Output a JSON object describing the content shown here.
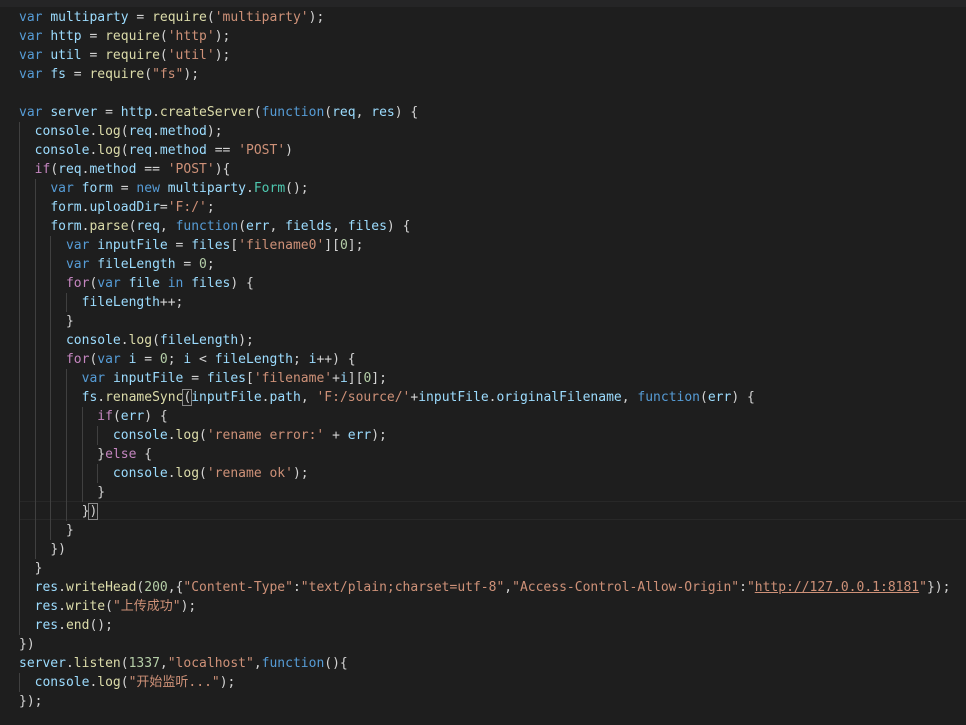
{
  "theme": {
    "background": "#1e1e1e",
    "keyword": "#569cd6",
    "control": "#c586c0",
    "variable": "#9cdcfe",
    "function": "#dcdcaa",
    "class": "#4ec9b0",
    "string": "#ce9178",
    "number": "#b5cea8",
    "plain": "#d4d4d4"
  },
  "editor": {
    "language": "javascript",
    "current_line": 27,
    "lines": [
      {
        "indent": 0,
        "tokens": [
          [
            "kw",
            "var"
          ],
          [
            "t",
            " "
          ],
          [
            "v",
            "multiparty"
          ],
          [
            "t",
            " = "
          ],
          [
            "f",
            "require"
          ],
          [
            "t",
            "("
          ],
          [
            "s",
            "'multiparty'"
          ],
          [
            "t",
            ");"
          ]
        ]
      },
      {
        "indent": 0,
        "tokens": [
          [
            "kw",
            "var"
          ],
          [
            "t",
            " "
          ],
          [
            "v",
            "http"
          ],
          [
            "t",
            " = "
          ],
          [
            "f",
            "require"
          ],
          [
            "t",
            "("
          ],
          [
            "s",
            "'http'"
          ],
          [
            "t",
            ");"
          ]
        ]
      },
      {
        "indent": 0,
        "tokens": [
          [
            "kw",
            "var"
          ],
          [
            "t",
            " "
          ],
          [
            "v",
            "util"
          ],
          [
            "t",
            " = "
          ],
          [
            "f",
            "require"
          ],
          [
            "t",
            "("
          ],
          [
            "s",
            "'util'"
          ],
          [
            "t",
            ");"
          ]
        ]
      },
      {
        "indent": 0,
        "tokens": [
          [
            "kw",
            "var"
          ],
          [
            "t",
            " "
          ],
          [
            "v",
            "fs"
          ],
          [
            "t",
            " = "
          ],
          [
            "f",
            "require"
          ],
          [
            "t",
            "("
          ],
          [
            "s",
            "\"fs\""
          ],
          [
            "t",
            ");"
          ]
        ]
      },
      {
        "indent": 0,
        "tokens": []
      },
      {
        "indent": 0,
        "tokens": [
          [
            "kw",
            "var"
          ],
          [
            "t",
            " "
          ],
          [
            "v",
            "server"
          ],
          [
            "t",
            " = "
          ],
          [
            "v",
            "http"
          ],
          [
            "t",
            "."
          ],
          [
            "f",
            "createServer"
          ],
          [
            "t",
            "("
          ],
          [
            "kw",
            "function"
          ],
          [
            "t",
            "("
          ],
          [
            "v",
            "req"
          ],
          [
            "t",
            ", "
          ],
          [
            "v",
            "res"
          ],
          [
            "t",
            ") {"
          ]
        ]
      },
      {
        "indent": 1,
        "tokens": [
          [
            "v",
            "console"
          ],
          [
            "t",
            "."
          ],
          [
            "f",
            "log"
          ],
          [
            "t",
            "("
          ],
          [
            "v",
            "req"
          ],
          [
            "t",
            "."
          ],
          [
            "v",
            "method"
          ],
          [
            "t",
            ");"
          ]
        ]
      },
      {
        "indent": 1,
        "tokens": [
          [
            "v",
            "console"
          ],
          [
            "t",
            "."
          ],
          [
            "f",
            "log"
          ],
          [
            "t",
            "("
          ],
          [
            "v",
            "req"
          ],
          [
            "t",
            "."
          ],
          [
            "v",
            "method"
          ],
          [
            "t",
            " == "
          ],
          [
            "s",
            "'POST'"
          ],
          [
            "t",
            ")"
          ]
        ]
      },
      {
        "indent": 1,
        "tokens": [
          [
            "c",
            "if"
          ],
          [
            "t",
            "("
          ],
          [
            "v",
            "req"
          ],
          [
            "t",
            "."
          ],
          [
            "v",
            "method"
          ],
          [
            "t",
            " == "
          ],
          [
            "s",
            "'POST'"
          ],
          [
            "t",
            "){"
          ]
        ]
      },
      {
        "indent": 2,
        "tokens": [
          [
            "kw",
            "var"
          ],
          [
            "t",
            " "
          ],
          [
            "v",
            "form"
          ],
          [
            "t",
            " = "
          ],
          [
            "kw",
            "new"
          ],
          [
            "t",
            " "
          ],
          [
            "v",
            "multiparty"
          ],
          [
            "t",
            "."
          ],
          [
            "cl",
            "Form"
          ],
          [
            "t",
            "();"
          ]
        ]
      },
      {
        "indent": 2,
        "tokens": [
          [
            "v",
            "form"
          ],
          [
            "t",
            "."
          ],
          [
            "v",
            "uploadDir"
          ],
          [
            "t",
            "="
          ],
          [
            "s",
            "'F:/'"
          ],
          [
            "t",
            ";"
          ]
        ]
      },
      {
        "indent": 2,
        "tokens": [
          [
            "v",
            "form"
          ],
          [
            "t",
            "."
          ],
          [
            "f",
            "parse"
          ],
          [
            "t",
            "("
          ],
          [
            "v",
            "req"
          ],
          [
            "t",
            ", "
          ],
          [
            "kw",
            "function"
          ],
          [
            "t",
            "("
          ],
          [
            "v",
            "err"
          ],
          [
            "t",
            ", "
          ],
          [
            "v",
            "fields"
          ],
          [
            "t",
            ", "
          ],
          [
            "v",
            "files"
          ],
          [
            "t",
            ") {"
          ]
        ]
      },
      {
        "indent": 3,
        "tokens": [
          [
            "kw",
            "var"
          ],
          [
            "t",
            " "
          ],
          [
            "v",
            "inputFile"
          ],
          [
            "t",
            " = "
          ],
          [
            "v",
            "files"
          ],
          [
            "t",
            "["
          ],
          [
            "s",
            "'filename0'"
          ],
          [
            "t",
            "]["
          ],
          [
            "n",
            "0"
          ],
          [
            "t",
            "];"
          ]
        ]
      },
      {
        "indent": 3,
        "tokens": [
          [
            "kw",
            "var"
          ],
          [
            "t",
            " "
          ],
          [
            "v",
            "fileLength"
          ],
          [
            "t",
            " = "
          ],
          [
            "n",
            "0"
          ],
          [
            "t",
            ";"
          ]
        ]
      },
      {
        "indent": 3,
        "tokens": [
          [
            "c",
            "for"
          ],
          [
            "t",
            "("
          ],
          [
            "kw",
            "var"
          ],
          [
            "t",
            " "
          ],
          [
            "v",
            "file"
          ],
          [
            "t",
            " "
          ],
          [
            "kw",
            "in"
          ],
          [
            "t",
            " "
          ],
          [
            "v",
            "files"
          ],
          [
            "t",
            ") {"
          ]
        ]
      },
      {
        "indent": 4,
        "tokens": [
          [
            "v",
            "fileLength"
          ],
          [
            "t",
            "++;"
          ]
        ]
      },
      {
        "indent": 3,
        "tokens": [
          [
            "t",
            "}"
          ]
        ]
      },
      {
        "indent": 3,
        "tokens": [
          [
            "v",
            "console"
          ],
          [
            "t",
            "."
          ],
          [
            "f",
            "log"
          ],
          [
            "t",
            "("
          ],
          [
            "v",
            "fileLength"
          ],
          [
            "t",
            ");"
          ]
        ]
      },
      {
        "indent": 3,
        "tokens": [
          [
            "c",
            "for"
          ],
          [
            "t",
            "("
          ],
          [
            "kw",
            "var"
          ],
          [
            "t",
            " "
          ],
          [
            "v",
            "i"
          ],
          [
            "t",
            " = "
          ],
          [
            "n",
            "0"
          ],
          [
            "t",
            "; "
          ],
          [
            "v",
            "i"
          ],
          [
            "t",
            " < "
          ],
          [
            "v",
            "fileLength"
          ],
          [
            "t",
            "; "
          ],
          [
            "v",
            "i"
          ],
          [
            "t",
            "++) {"
          ]
        ]
      },
      {
        "indent": 4,
        "tokens": [
          [
            "kw",
            "var"
          ],
          [
            "t",
            " "
          ],
          [
            "v",
            "inputFile"
          ],
          [
            "t",
            " = "
          ],
          [
            "v",
            "files"
          ],
          [
            "t",
            "["
          ],
          [
            "s",
            "'filename'"
          ],
          [
            "t",
            "+"
          ],
          [
            "v",
            "i"
          ],
          [
            "t",
            "]["
          ],
          [
            "n",
            "0"
          ],
          [
            "t",
            "];"
          ]
        ]
      },
      {
        "indent": 4,
        "tokens": [
          [
            "v",
            "fs"
          ],
          [
            "t",
            "."
          ],
          [
            "f",
            "renameSync"
          ],
          [
            "bm",
            "("
          ],
          [
            "v",
            "inputFile"
          ],
          [
            "t",
            "."
          ],
          [
            "v",
            "path"
          ],
          [
            "t",
            ", "
          ],
          [
            "s",
            "'F:/source/'"
          ],
          [
            "t",
            "+"
          ],
          [
            "v",
            "inputFile"
          ],
          [
            "t",
            "."
          ],
          [
            "v",
            "originalFilename"
          ],
          [
            "t",
            ", "
          ],
          [
            "kw",
            "function"
          ],
          [
            "t",
            "("
          ],
          [
            "v",
            "err"
          ],
          [
            "t",
            ") {"
          ]
        ]
      },
      {
        "indent": 5,
        "tokens": [
          [
            "c",
            "if"
          ],
          [
            "t",
            "("
          ],
          [
            "v",
            "err"
          ],
          [
            "t",
            ") {"
          ]
        ]
      },
      {
        "indent": 6,
        "tokens": [
          [
            "v",
            "console"
          ],
          [
            "t",
            "."
          ],
          [
            "f",
            "log"
          ],
          [
            "t",
            "("
          ],
          [
            "s",
            "'rename error:'"
          ],
          [
            "t",
            " + "
          ],
          [
            "v",
            "err"
          ],
          [
            "t",
            ");"
          ]
        ]
      },
      {
        "indent": 5,
        "tokens": [
          [
            "t",
            "}"
          ],
          [
            "c",
            "else"
          ],
          [
            "t",
            " {"
          ]
        ]
      },
      {
        "indent": 6,
        "tokens": [
          [
            "v",
            "console"
          ],
          [
            "t",
            "."
          ],
          [
            "f",
            "log"
          ],
          [
            "t",
            "("
          ],
          [
            "s",
            "'rename ok'"
          ],
          [
            "t",
            ");"
          ]
        ]
      },
      {
        "indent": 5,
        "tokens": [
          [
            "t",
            "}"
          ]
        ]
      },
      {
        "indent": 4,
        "tokens": [
          [
            "t",
            "}"
          ],
          [
            "bm",
            ")"
          ]
        ]
      },
      {
        "indent": 3,
        "tokens": [
          [
            "t",
            "}"
          ]
        ]
      },
      {
        "indent": 2,
        "tokens": [
          [
            "t",
            "})"
          ]
        ]
      },
      {
        "indent": 1,
        "tokens": [
          [
            "t",
            "}"
          ]
        ]
      },
      {
        "indent": 1,
        "tokens": [
          [
            "v",
            "res"
          ],
          [
            "t",
            "."
          ],
          [
            "f",
            "writeHead"
          ],
          [
            "t",
            "("
          ],
          [
            "n",
            "200"
          ],
          [
            "t",
            ",{"
          ],
          [
            "s",
            "\"Content-Type\""
          ],
          [
            "t",
            ":"
          ],
          [
            "s",
            "\"text/plain;charset=utf-8\""
          ],
          [
            "t",
            ","
          ],
          [
            "s",
            "\"Access-Control-Allow-Origin\""
          ],
          [
            "t",
            ":"
          ],
          [
            "s",
            "\""
          ],
          [
            "u",
            "http://127.0.0.1:8181"
          ],
          [
            "s",
            "\""
          ],
          [
            "t",
            "});"
          ]
        ]
      },
      {
        "indent": 1,
        "tokens": [
          [
            "v",
            "res"
          ],
          [
            "t",
            "."
          ],
          [
            "f",
            "write"
          ],
          [
            "t",
            "("
          ],
          [
            "s",
            "\"上传成功\""
          ],
          [
            "t",
            ");"
          ]
        ]
      },
      {
        "indent": 1,
        "tokens": [
          [
            "v",
            "res"
          ],
          [
            "t",
            "."
          ],
          [
            "f",
            "end"
          ],
          [
            "t",
            "();"
          ]
        ]
      },
      {
        "indent": 0,
        "tokens": [
          [
            "t",
            "})"
          ]
        ]
      },
      {
        "indent": 0,
        "tokens": [
          [
            "v",
            "server"
          ],
          [
            "t",
            "."
          ],
          [
            "f",
            "listen"
          ],
          [
            "t",
            "("
          ],
          [
            "n",
            "1337"
          ],
          [
            "t",
            ","
          ],
          [
            "s",
            "\"localhost\""
          ],
          [
            "t",
            ","
          ],
          [
            "kw",
            "function"
          ],
          [
            "t",
            "(){"
          ]
        ]
      },
      {
        "indent": 1,
        "tokens": [
          [
            "v",
            "console"
          ],
          [
            "t",
            "."
          ],
          [
            "f",
            "log"
          ],
          [
            "t",
            "("
          ],
          [
            "s",
            "\"开始监听...\""
          ],
          [
            "t",
            ");"
          ]
        ]
      },
      {
        "indent": 0,
        "tokens": [
          [
            "t",
            "});"
          ]
        ]
      }
    ]
  }
}
